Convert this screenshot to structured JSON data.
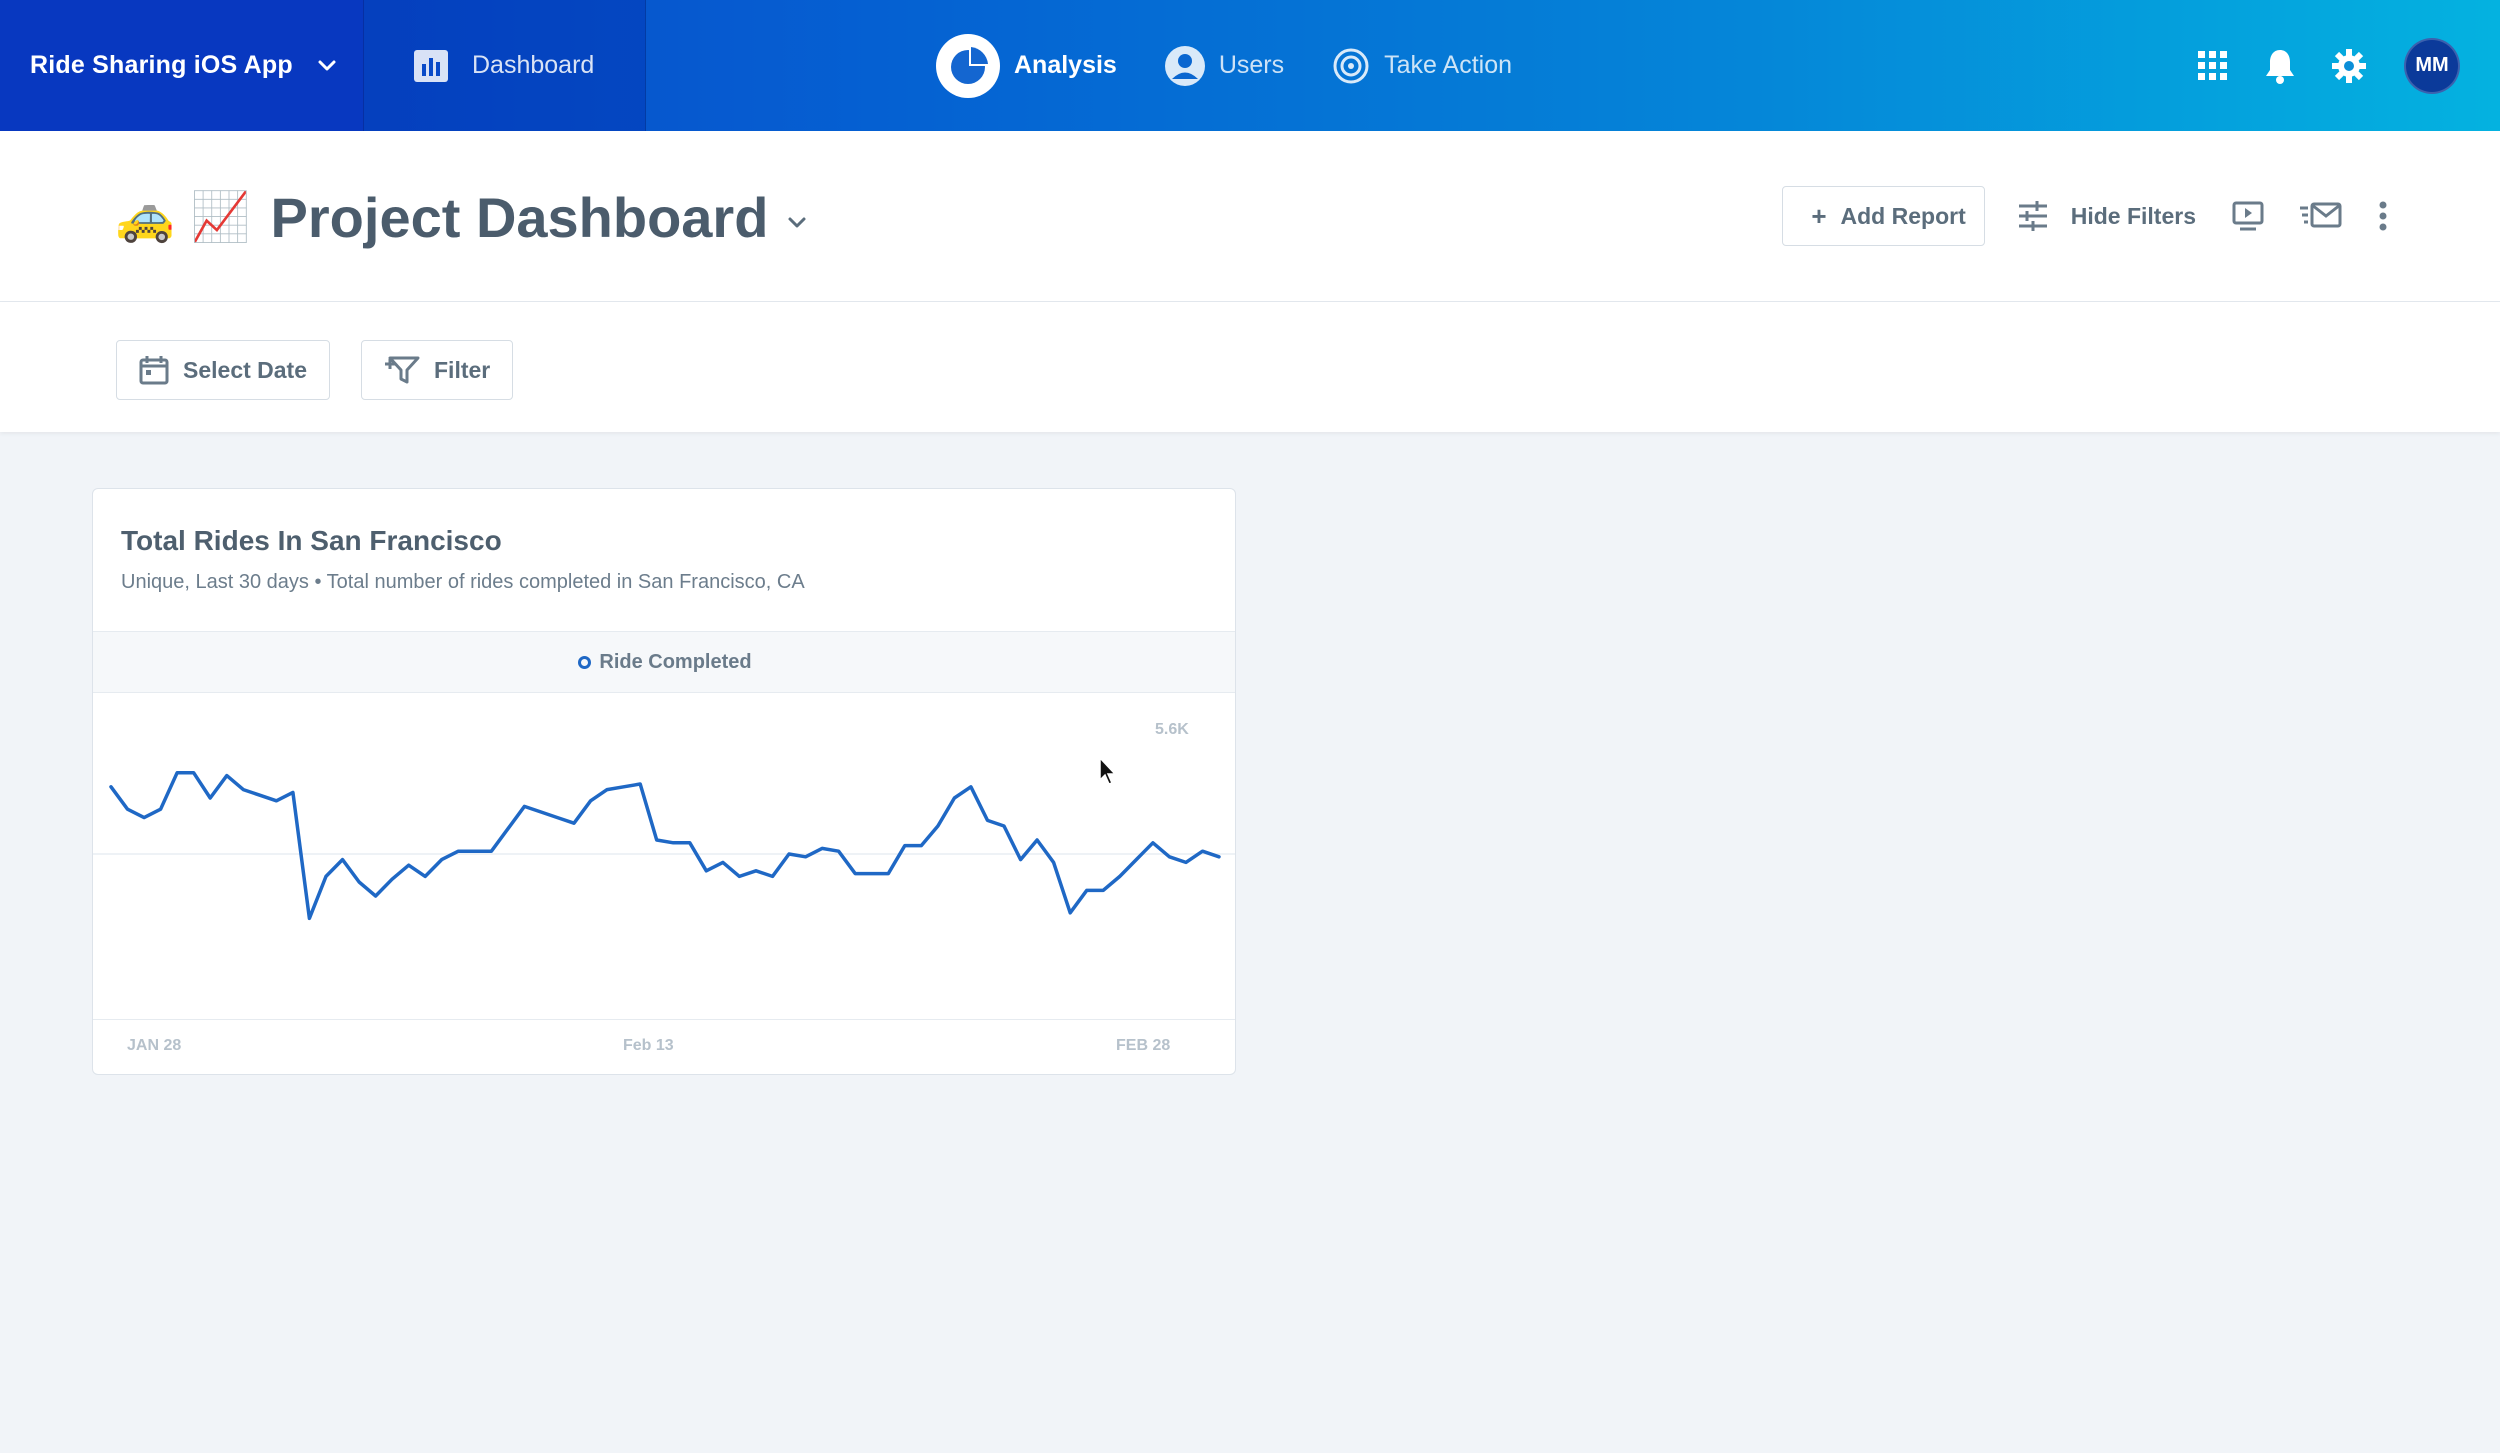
{
  "topnav": {
    "project_name": "Ride Sharing iOS App",
    "dashboard_label": "Dashboard",
    "items": [
      {
        "label": "Analysis",
        "active": true
      },
      {
        "label": "Users",
        "active": false
      },
      {
        "label": "Take Action",
        "active": false
      }
    ],
    "avatar_initials": "MM"
  },
  "header": {
    "emoji_1": "🚕",
    "emoji_2": "📈",
    "title": "Project Dashboard",
    "add_report_label": "Add Report",
    "hide_filters_label": "Hide Filters"
  },
  "filters": {
    "select_date_label": "Select Date",
    "filter_label": "Filter"
  },
  "report": {
    "title": "Total Rides In San Francisco",
    "subtitle": "Unique, Last 30 days • Total number of rides completed in San Francisco, CA",
    "legend": "Ride Completed"
  },
  "chart_data": {
    "type": "line",
    "series": [
      {
        "name": "Ride Completed",
        "color": "#1f68c5",
        "values": [
          0.74,
          0.66,
          0.63,
          0.66,
          0.79,
          0.79,
          0.7,
          0.78,
          0.73,
          0.71,
          0.69,
          0.72,
          0.27,
          0.42,
          0.48,
          0.4,
          0.35,
          0.41,
          0.46,
          0.42,
          0.48,
          0.51,
          0.51,
          0.51,
          0.59,
          0.67,
          0.65,
          0.63,
          0.61,
          0.69,
          0.73,
          0.74,
          0.75,
          0.55,
          0.54,
          0.54,
          0.44,
          0.47,
          0.42,
          0.44,
          0.42,
          0.5,
          0.49,
          0.52,
          0.51,
          0.43,
          0.43,
          0.43,
          0.53,
          0.53,
          0.6,
          0.7,
          0.74,
          0.62,
          0.6,
          0.48,
          0.55,
          0.47,
          0.29,
          0.37,
          0.37,
          0.42,
          0.48,
          0.54,
          0.49,
          0.47,
          0.51,
          0.49
        ]
      }
    ],
    "x_tick_labels": [
      "JAN 28",
      "Feb 13",
      "FEB 28"
    ],
    "y_max_label": "5.6K",
    "grid": true
  },
  "colors": {
    "accent": "#1f68c5",
    "nav_start": "#0a3fc4",
    "nav_end": "#04b2e0"
  }
}
